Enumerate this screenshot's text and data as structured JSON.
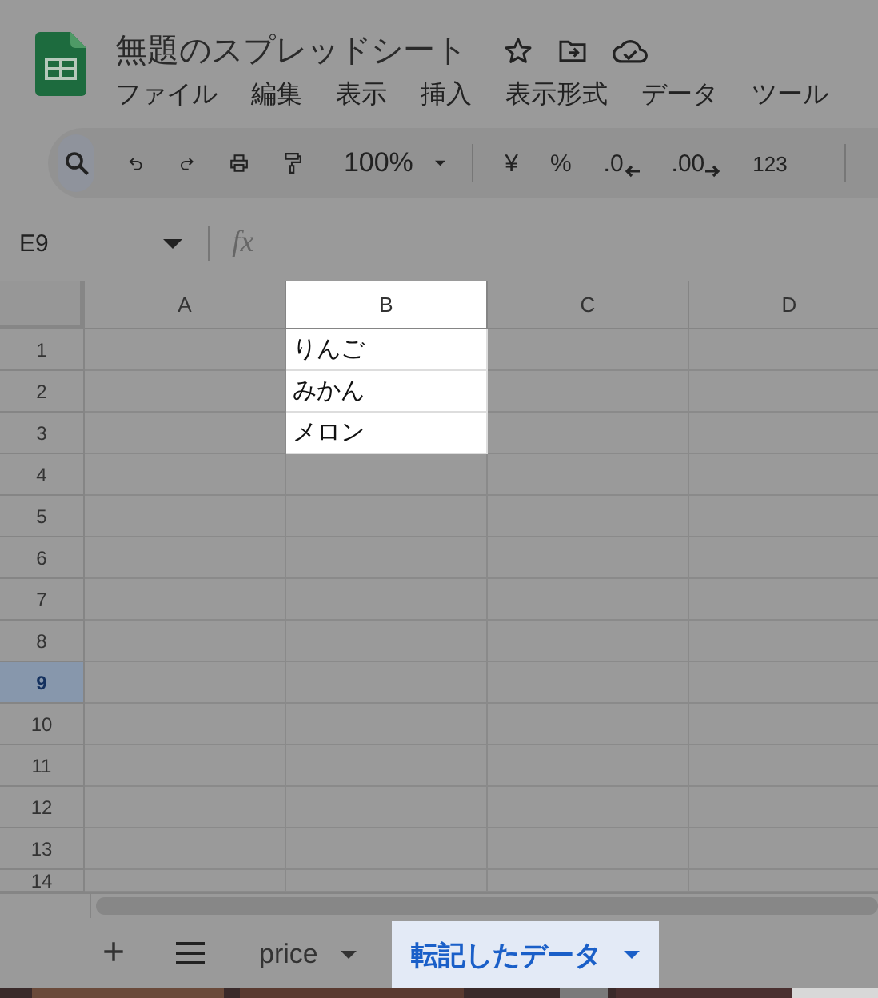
{
  "app": {
    "title": "無題のスプレッドシート",
    "menus": [
      "ファイル",
      "編集",
      "表示",
      "挿入",
      "表示形式",
      "データ",
      "ツール"
    ]
  },
  "toolbar": {
    "zoom": "100%",
    "formats": [
      "¥",
      "%",
      ".0",
      ".00",
      "123"
    ]
  },
  "formula_bar": {
    "cell": "E9",
    "fx": "fx"
  },
  "columns": [
    {
      "label": "A",
      "spotlight": false
    },
    {
      "label": "B",
      "spotlight": true
    },
    {
      "label": "C",
      "spotlight": false
    },
    {
      "label": "D",
      "spotlight": false
    }
  ],
  "rows": [
    {
      "number": "1",
      "selected": false,
      "b": "りんご"
    },
    {
      "number": "2",
      "selected": false,
      "b": "みかん"
    },
    {
      "number": "3",
      "selected": false,
      "b": "メロン"
    },
    {
      "number": "4",
      "selected": false
    },
    {
      "number": "5",
      "selected": false
    },
    {
      "number": "6",
      "selected": false
    },
    {
      "number": "7",
      "selected": false
    },
    {
      "number": "8",
      "selected": false
    },
    {
      "number": "9",
      "selected": true
    },
    {
      "number": "10",
      "selected": false
    },
    {
      "number": "11",
      "selected": false
    },
    {
      "number": "12",
      "selected": false
    },
    {
      "number": "13",
      "selected": false
    },
    {
      "number": "14",
      "selected": false
    }
  ],
  "sheet_bar": {
    "add": "+"
  },
  "sheets": [
    {
      "name": "price",
      "selected": false
    },
    {
      "name": "転記したデータ",
      "selected": true
    }
  ]
}
